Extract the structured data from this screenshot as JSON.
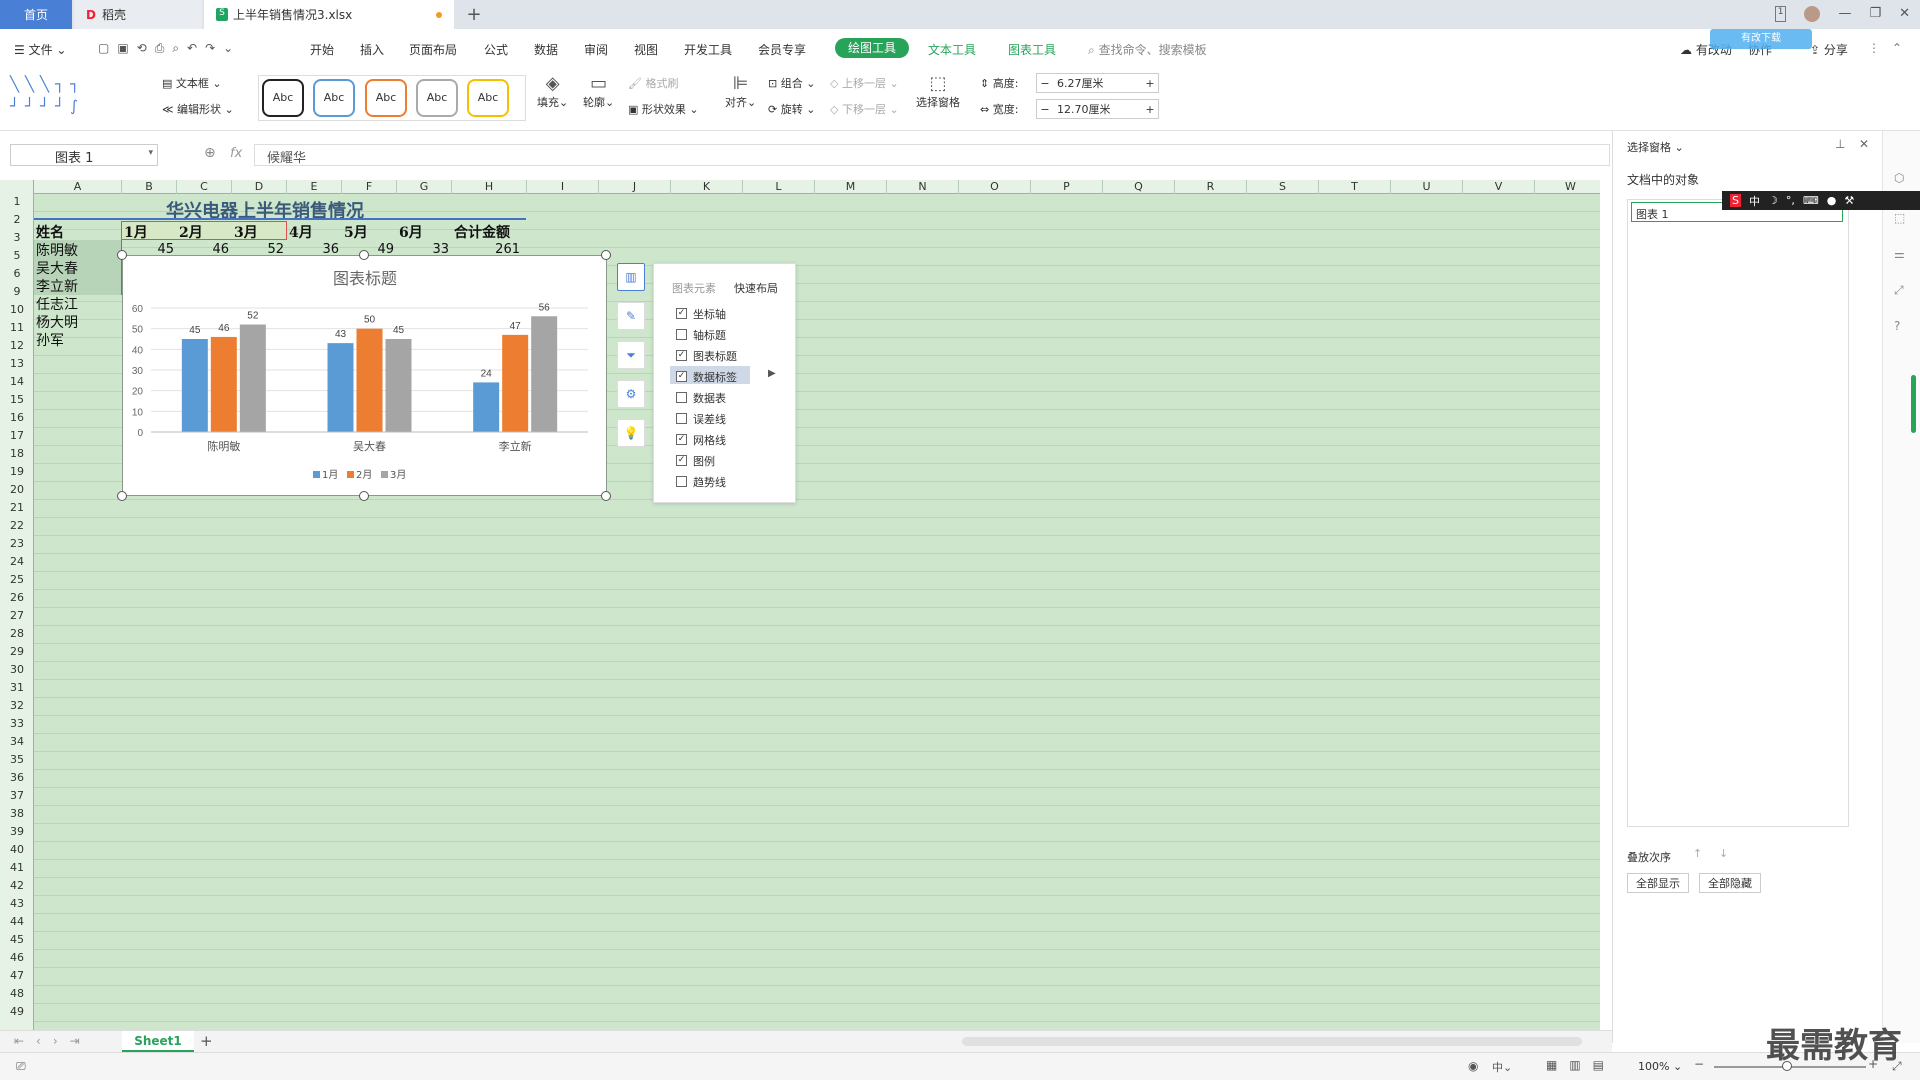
{
  "tabs": [
    {
      "label": "首页"
    },
    {
      "label": "稻壳"
    },
    {
      "label": "上半年销售情况3.xlsx"
    }
  ],
  "menu": {
    "file": "文件",
    "items": [
      "开始",
      "插入",
      "页面布局",
      "公式",
      "数据",
      "审阅",
      "视图",
      "开发工具",
      "会员专享"
    ],
    "drawing_tool": "绘图工具",
    "text_tool": "文本工具",
    "chart_tool": "图表工具",
    "search": "查找命令、搜索模板",
    "sync": "有改动",
    "share": "分享",
    "collab": "协作",
    "float_badge": "有改下载"
  },
  "ribbon": {
    "textbox": "文本框",
    "edit_shape": "编辑形状",
    "styles": [
      "Abc",
      "Abc",
      "Abc",
      "Abc",
      "Abc"
    ],
    "fill": "填充",
    "outline": "轮廓",
    "format_brush": "格式刷",
    "shape_effect": "形状效果",
    "align": "对齐",
    "group": "组合",
    "rotate": "旋转",
    "bring_forward": "上移一层",
    "send_backward": "下移一层",
    "select_pane": "选择窗格",
    "height_label": "高度:",
    "height_value": "6.27厘米",
    "width_label": "宽度:",
    "width_value": "12.70厘米"
  },
  "formula": {
    "name_box": "图表 1",
    "fx": "fx",
    "value": "候耀华"
  },
  "sheet": {
    "columns": [
      "A",
      "B",
      "C",
      "D",
      "E",
      "F",
      "G",
      "H",
      "I",
      "J",
      "K",
      "L",
      "M",
      "N",
      "O",
      "P",
      "Q",
      "R",
      "S",
      "T",
      "U",
      "V",
      "W"
    ],
    "rows": [
      "1",
      "2",
      "3",
      "5",
      "6",
      "9",
      "10",
      "11",
      "12",
      "13",
      "14",
      "15",
      "16",
      "17",
      "18",
      "19",
      "20",
      "21",
      "22",
      "23",
      "24",
      "25",
      "26",
      "27",
      "28",
      "29",
      "30",
      "31",
      "32",
      "33",
      "34",
      "35",
      "36",
      "37",
      "38",
      "39",
      "40",
      "41",
      "42",
      "43",
      "44",
      "45",
      "46",
      "47",
      "48",
      "49"
    ],
    "title": "华兴电器上半年销售情况",
    "header": [
      "姓名",
      "1月",
      "2月",
      "3月",
      "4月",
      "5月",
      "6月",
      "合计金额"
    ],
    "row3": [
      "陈明敏",
      "45",
      "46",
      "52",
      "36",
      "49",
      "33",
      "261"
    ],
    "names": [
      "吴大春",
      "李立新",
      "任志江",
      "杨大明",
      "孙军"
    ]
  },
  "chart_data": {
    "type": "bar",
    "title": "图表标题",
    "categories": [
      "陈明敏",
      "吴大春",
      "李立新"
    ],
    "series": [
      {
        "name": "1月",
        "values": [
          45,
          43,
          24
        ],
        "color": "#5b9bd5"
      },
      {
        "name": "2月",
        "values": [
          46,
          50,
          47
        ],
        "color": "#ed7d31"
      },
      {
        "name": "3月",
        "values": [
          52,
          45,
          56
        ],
        "color": "#a5a5a5"
      }
    ],
    "y_ticks": [
      "0",
      "10",
      "20",
      "30",
      "40",
      "50",
      "60"
    ],
    "ylim": [
      0,
      60
    ],
    "grid": true,
    "legend": "bottom"
  },
  "popup": {
    "tab1": "图表元素",
    "tab2": "快速布局",
    "items": [
      {
        "label": "坐标轴",
        "checked": true
      },
      {
        "label": "轴标题",
        "checked": false
      },
      {
        "label": "图表标题",
        "checked": true
      },
      {
        "label": "数据标签",
        "checked": true
      },
      {
        "label": "数据表",
        "checked": false
      },
      {
        "label": "误差线",
        "checked": false
      },
      {
        "label": "网格线",
        "checked": true
      },
      {
        "label": "图例",
        "checked": true
      },
      {
        "label": "趋势线",
        "checked": false
      }
    ]
  },
  "panel": {
    "title": "选择窗格",
    "objects_label": "文档中的对象",
    "object": "图表 1",
    "order": "叠放次序",
    "show_all": "全部显示",
    "hide_all": "全部隐藏"
  },
  "sheettab": "Sheet1",
  "status": {
    "zoom": "100%",
    "ime": "中"
  },
  "watermark": "最需教育"
}
